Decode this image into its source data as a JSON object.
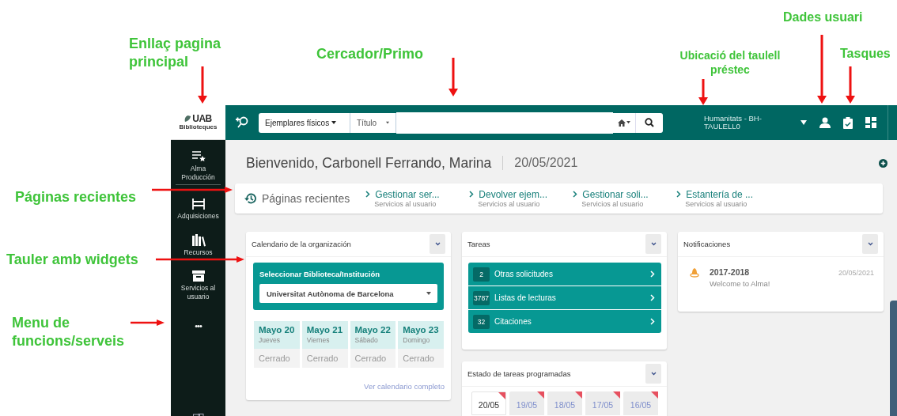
{
  "annotations": [
    {
      "text": "Enllaç pagina principal"
    },
    {
      "text": "Cercador/Primo"
    },
    {
      "text": "Ubicació del taulell préstec"
    },
    {
      "text": "Dades usuari"
    },
    {
      "text": "Tasques"
    },
    {
      "text": "Páginas recientes"
    },
    {
      "text": "Tauler amb widgets"
    },
    {
      "text": "Menu de funcions/serveis"
    }
  ],
  "logo": {
    "name": "UAB",
    "subtitle": "Biblioteques"
  },
  "search": {
    "scope": "Ejemplares físicos",
    "field": "Título"
  },
  "location": "Humanitats - BH-TAULELL0",
  "sidebar": {
    "items": [
      {
        "label": "Alma Producción"
      },
      {
        "label": "Adquisiciones"
      },
      {
        "label": "Recursos"
      },
      {
        "label": "Servicios al usuario"
      }
    ],
    "more": "•••"
  },
  "welcome": {
    "title": "Bienvenido, Carbonell Ferrando, Marina",
    "date": "20/05/2021"
  },
  "recent_pages": {
    "title": "Páginas recientes",
    "links": [
      {
        "label": "Gestionar ser...",
        "section": "Servicios al usuario"
      },
      {
        "label": "Devolver ejem...",
        "section": "Servicios al usuario"
      },
      {
        "label": "Gestionar soli...",
        "section": "Servicios al usuario"
      },
      {
        "label": "Estantería de ...",
        "section": "Servicios al usuario"
      }
    ]
  },
  "calendar": {
    "title": "Calendario de la organización",
    "selector_label": "Seleccionar Biblioteca/Institución",
    "selector_value": "Universitat Autònoma de Barcelona",
    "days": [
      {
        "date": "Mayo 20",
        "weekday": "Jueves",
        "status": "Cerrado"
      },
      {
        "date": "Mayo 21",
        "weekday": "Viernes",
        "status": "Cerrado"
      },
      {
        "date": "Mayo 22",
        "weekday": "Sábado",
        "status": "Cerrado"
      },
      {
        "date": "Mayo 23",
        "weekday": "Domingo",
        "status": "Cerrado"
      }
    ],
    "link": "Ver calendario completo"
  },
  "tasks": {
    "title": "Tareas",
    "items": [
      {
        "count": "2",
        "label": "Otras solicitudes"
      },
      {
        "count": "3787",
        "label": "Listas de lecturas"
      },
      {
        "count": "32",
        "label": "Citaciones"
      }
    ]
  },
  "notifications": {
    "title": "Notificaciones",
    "items": [
      {
        "title": "2017-2018",
        "message": "Welcome to Alma!",
        "date": "20/05/2021"
      }
    ]
  },
  "scheduled_tasks": {
    "title": "Estado de tareas programadas",
    "dates": [
      {
        "label": "20/05",
        "selected": true
      },
      {
        "label": "19/05",
        "selected": false
      },
      {
        "label": "18/05",
        "selected": false
      },
      {
        "label": "17/05",
        "selected": false
      },
      {
        "label": "16/05",
        "selected": false
      }
    ]
  }
}
